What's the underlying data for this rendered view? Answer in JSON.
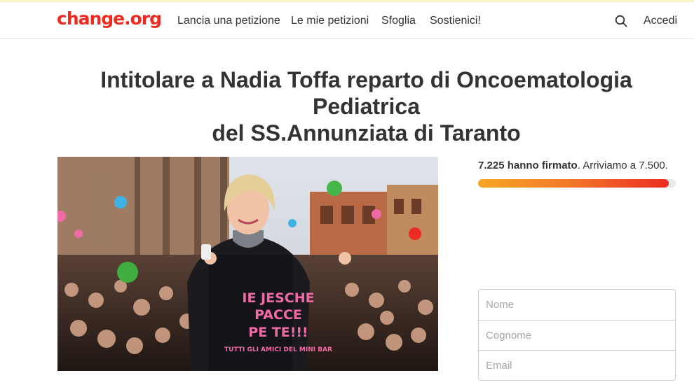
{
  "header": {
    "logo": "change.org",
    "nav": [
      {
        "label": "Lancia una petizione"
      },
      {
        "label": "Le mie petizioni"
      },
      {
        "label": "Sfoglia"
      },
      {
        "label": "Sostienici!"
      }
    ],
    "search_icon": "search-icon",
    "login_label": "Accedi"
  },
  "petition": {
    "title_line1": "Intitolare a Nadia Toffa reparto di Oncoematologia Pediatrica",
    "title_line2": "del SS.Annunziata di Taranto",
    "image": {
      "shirt_text_1": "IE JESCHE",
      "shirt_text_2": "PACCE",
      "shirt_text_3": "PE TE!!!",
      "shirt_text_4": "TUTTI GLI AMICI DEL MINI BAR"
    }
  },
  "signatures": {
    "count_label": "7.225 hanno firmato",
    "goal_label": ". Arriviamo a 7.500.",
    "progress": 0.963
  },
  "form": {
    "first_name_placeholder": "Nome",
    "last_name_placeholder": "Cognome",
    "email_placeholder": "Email"
  },
  "colors": {
    "brand": "#ec2c22",
    "progress_start": "#f5a623",
    "progress_end": "#ec2c22"
  }
}
